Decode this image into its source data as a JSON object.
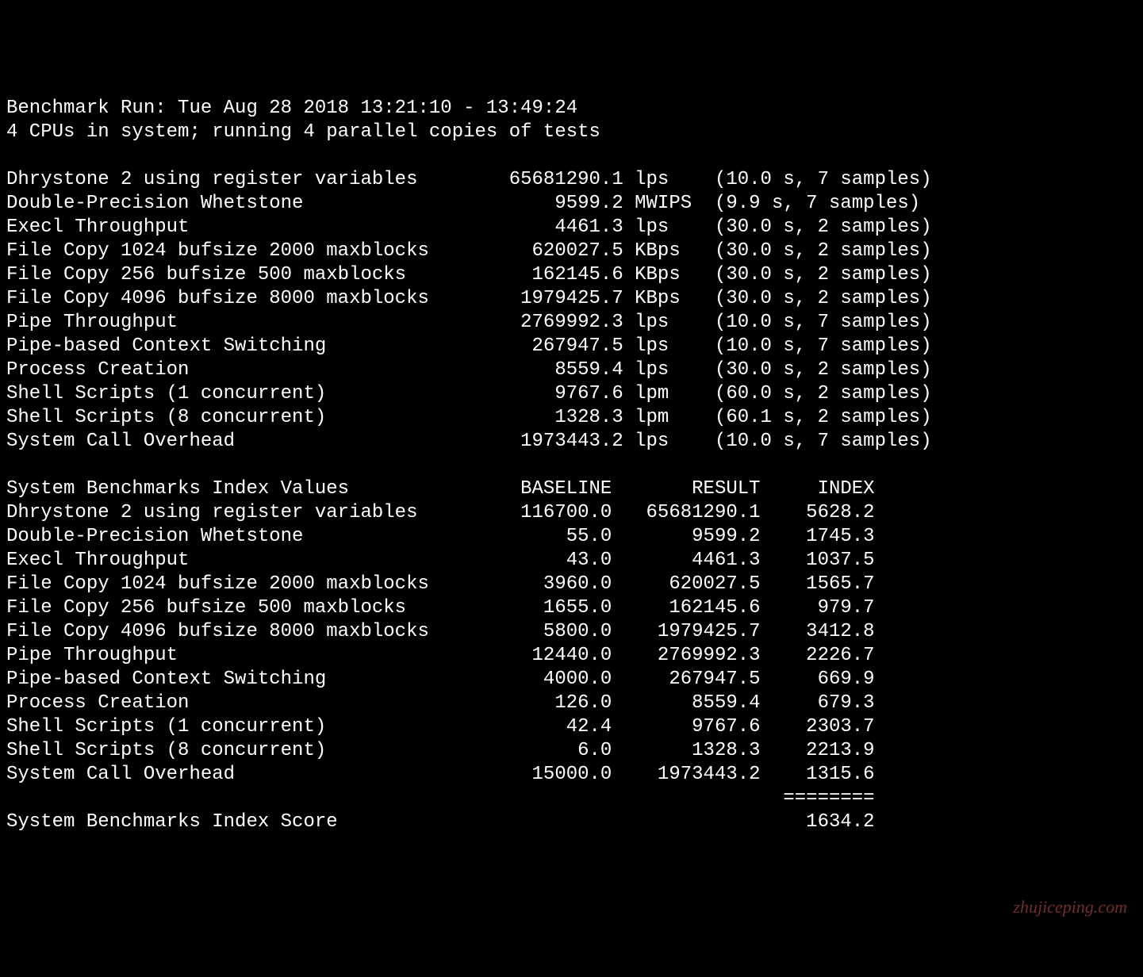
{
  "header": {
    "line1": "Benchmark Run: Tue Aug 28 2018 13:21:10 - 13:49:24",
    "line2": "4 CPUs in system; running 4 parallel copies of tests"
  },
  "raw_results": [
    {
      "name": "Dhrystone 2 using register variables",
      "value": "65681290.1",
      "unit": "lps  ",
      "timing": "(10.0 s, 7 samples)"
    },
    {
      "name": "Double-Precision Whetstone",
      "value": "9599.2",
      "unit": "MWIPS",
      "timing": "(9.9 s, 7 samples)"
    },
    {
      "name": "Execl Throughput",
      "value": "4461.3",
      "unit": "lps  ",
      "timing": "(30.0 s, 2 samples)"
    },
    {
      "name": "File Copy 1024 bufsize 2000 maxblocks",
      "value": "620027.5",
      "unit": "KBps ",
      "timing": "(30.0 s, 2 samples)"
    },
    {
      "name": "File Copy 256 bufsize 500 maxblocks",
      "value": "162145.6",
      "unit": "KBps ",
      "timing": "(30.0 s, 2 samples)"
    },
    {
      "name": "File Copy 4096 bufsize 8000 maxblocks",
      "value": "1979425.7",
      "unit": "KBps ",
      "timing": "(30.0 s, 2 samples)"
    },
    {
      "name": "Pipe Throughput",
      "value": "2769992.3",
      "unit": "lps  ",
      "timing": "(10.0 s, 7 samples)"
    },
    {
      "name": "Pipe-based Context Switching",
      "value": "267947.5",
      "unit": "lps  ",
      "timing": "(10.0 s, 7 samples)"
    },
    {
      "name": "Process Creation",
      "value": "8559.4",
      "unit": "lps  ",
      "timing": "(30.0 s, 2 samples)"
    },
    {
      "name": "Shell Scripts (1 concurrent)",
      "value": "9767.6",
      "unit": "lpm  ",
      "timing": "(60.0 s, 2 samples)"
    },
    {
      "name": "Shell Scripts (8 concurrent)",
      "value": "1328.3",
      "unit": "lpm  ",
      "timing": "(60.1 s, 2 samples)"
    },
    {
      "name": "System Call Overhead",
      "value": "1973443.2",
      "unit": "lps  ",
      "timing": "(10.0 s, 7 samples)"
    }
  ],
  "index_header": {
    "title": "System Benchmarks Index Values",
    "col_baseline": "BASELINE",
    "col_result": "RESULT",
    "col_index": "INDEX"
  },
  "index_results": [
    {
      "name": "Dhrystone 2 using register variables",
      "baseline": "116700.0",
      "result": "65681290.1",
      "index": "5628.2"
    },
    {
      "name": "Double-Precision Whetstone",
      "baseline": "55.0",
      "result": "9599.2",
      "index": "1745.3"
    },
    {
      "name": "Execl Throughput",
      "baseline": "43.0",
      "result": "4461.3",
      "index": "1037.5"
    },
    {
      "name": "File Copy 1024 bufsize 2000 maxblocks",
      "baseline": "3960.0",
      "result": "620027.5",
      "index": "1565.7"
    },
    {
      "name": "File Copy 256 bufsize 500 maxblocks",
      "baseline": "1655.0",
      "result": "162145.6",
      "index": "979.7"
    },
    {
      "name": "File Copy 4096 bufsize 8000 maxblocks",
      "baseline": "5800.0",
      "result": "1979425.7",
      "index": "3412.8"
    },
    {
      "name": "Pipe Throughput",
      "baseline": "12440.0",
      "result": "2769992.3",
      "index": "2226.7"
    },
    {
      "name": "Pipe-based Context Switching",
      "baseline": "4000.0",
      "result": "267947.5",
      "index": "669.9"
    },
    {
      "name": "Process Creation",
      "baseline": "126.0",
      "result": "8559.4",
      "index": "679.3"
    },
    {
      "name": "Shell Scripts (1 concurrent)",
      "baseline": "42.4",
      "result": "9767.6",
      "index": "2303.7"
    },
    {
      "name": "Shell Scripts (8 concurrent)",
      "baseline": "6.0",
      "result": "1328.3",
      "index": "2213.9"
    },
    {
      "name": "System Call Overhead",
      "baseline": "15000.0",
      "result": "1973443.2",
      "index": "1315.6"
    }
  ],
  "separator": "========",
  "final_score": {
    "label": "System Benchmarks Index Score",
    "value": "1634.2"
  },
  "watermark": "zhujiceping.com"
}
